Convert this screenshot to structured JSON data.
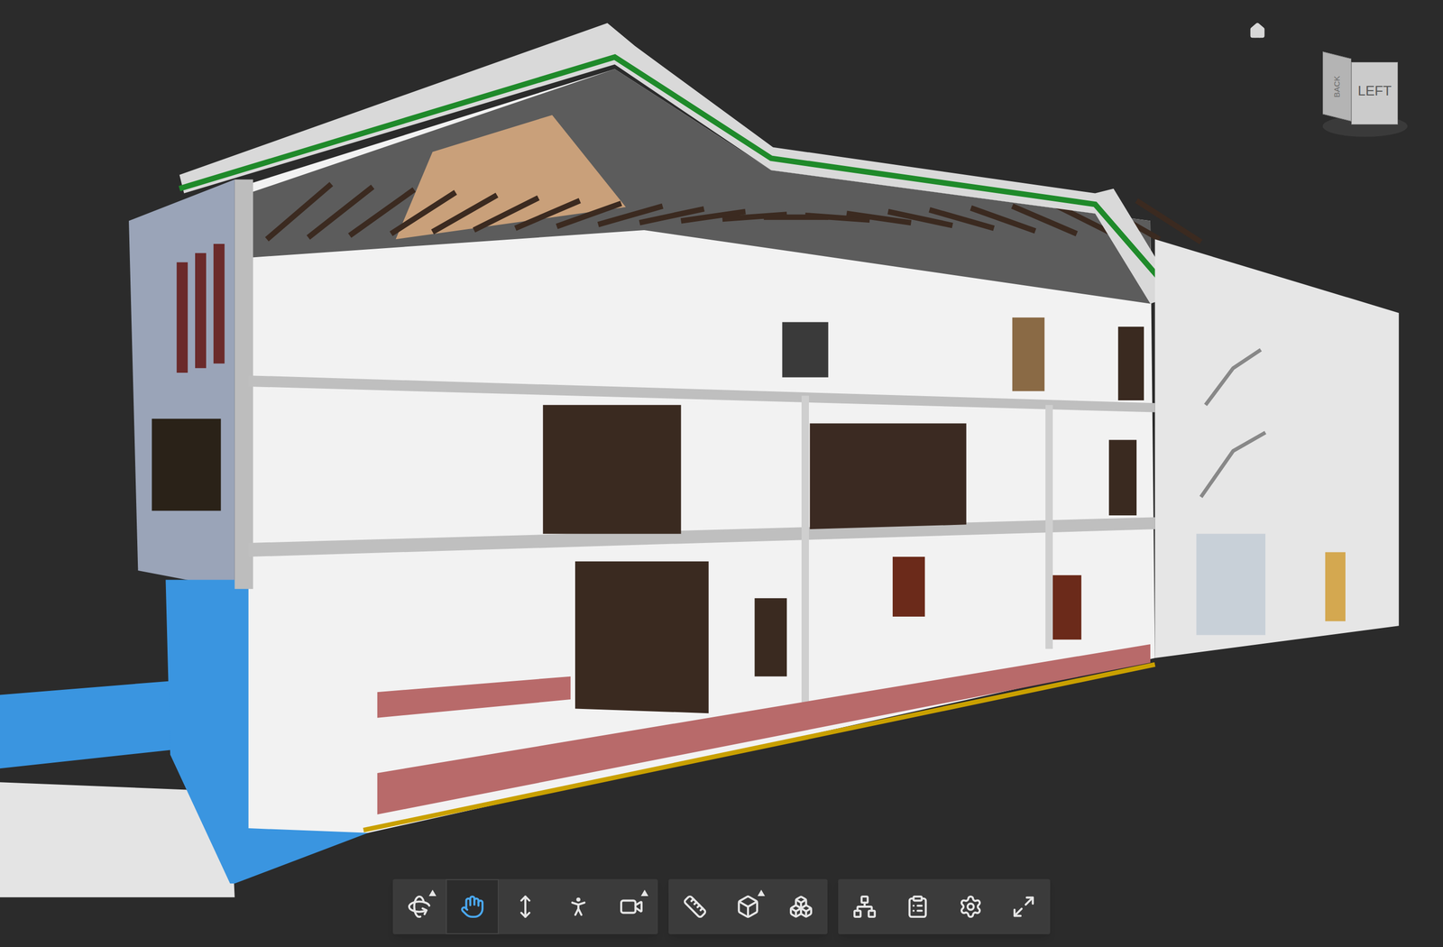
{
  "view_cube": {
    "faces": [
      {
        "label": "BACK"
      },
      {
        "label": "LEFT"
      }
    ]
  },
  "toolbar": {
    "groups": [
      {
        "buttons": [
          {
            "selected": false,
            "has_menu": true
          },
          {
            "selected": true,
            "has_menu": false
          },
          {
            "selected": false,
            "has_menu": false
          },
          {
            "selected": false,
            "has_menu": false
          },
          {
            "selected": false,
            "has_menu": true
          }
        ]
      },
      {
        "buttons": [
          {
            "selected": false,
            "has_menu": false
          },
          {
            "selected": false,
            "has_menu": true
          },
          {
            "selected": false,
            "has_menu": false
          }
        ]
      },
      {
        "buttons": [
          {
            "selected": false,
            "has_menu": false
          },
          {
            "selected": false,
            "has_menu": false
          },
          {
            "selected": false,
            "has_menu": false
          },
          {
            "selected": false,
            "has_menu": false
          }
        ]
      }
    ]
  }
}
